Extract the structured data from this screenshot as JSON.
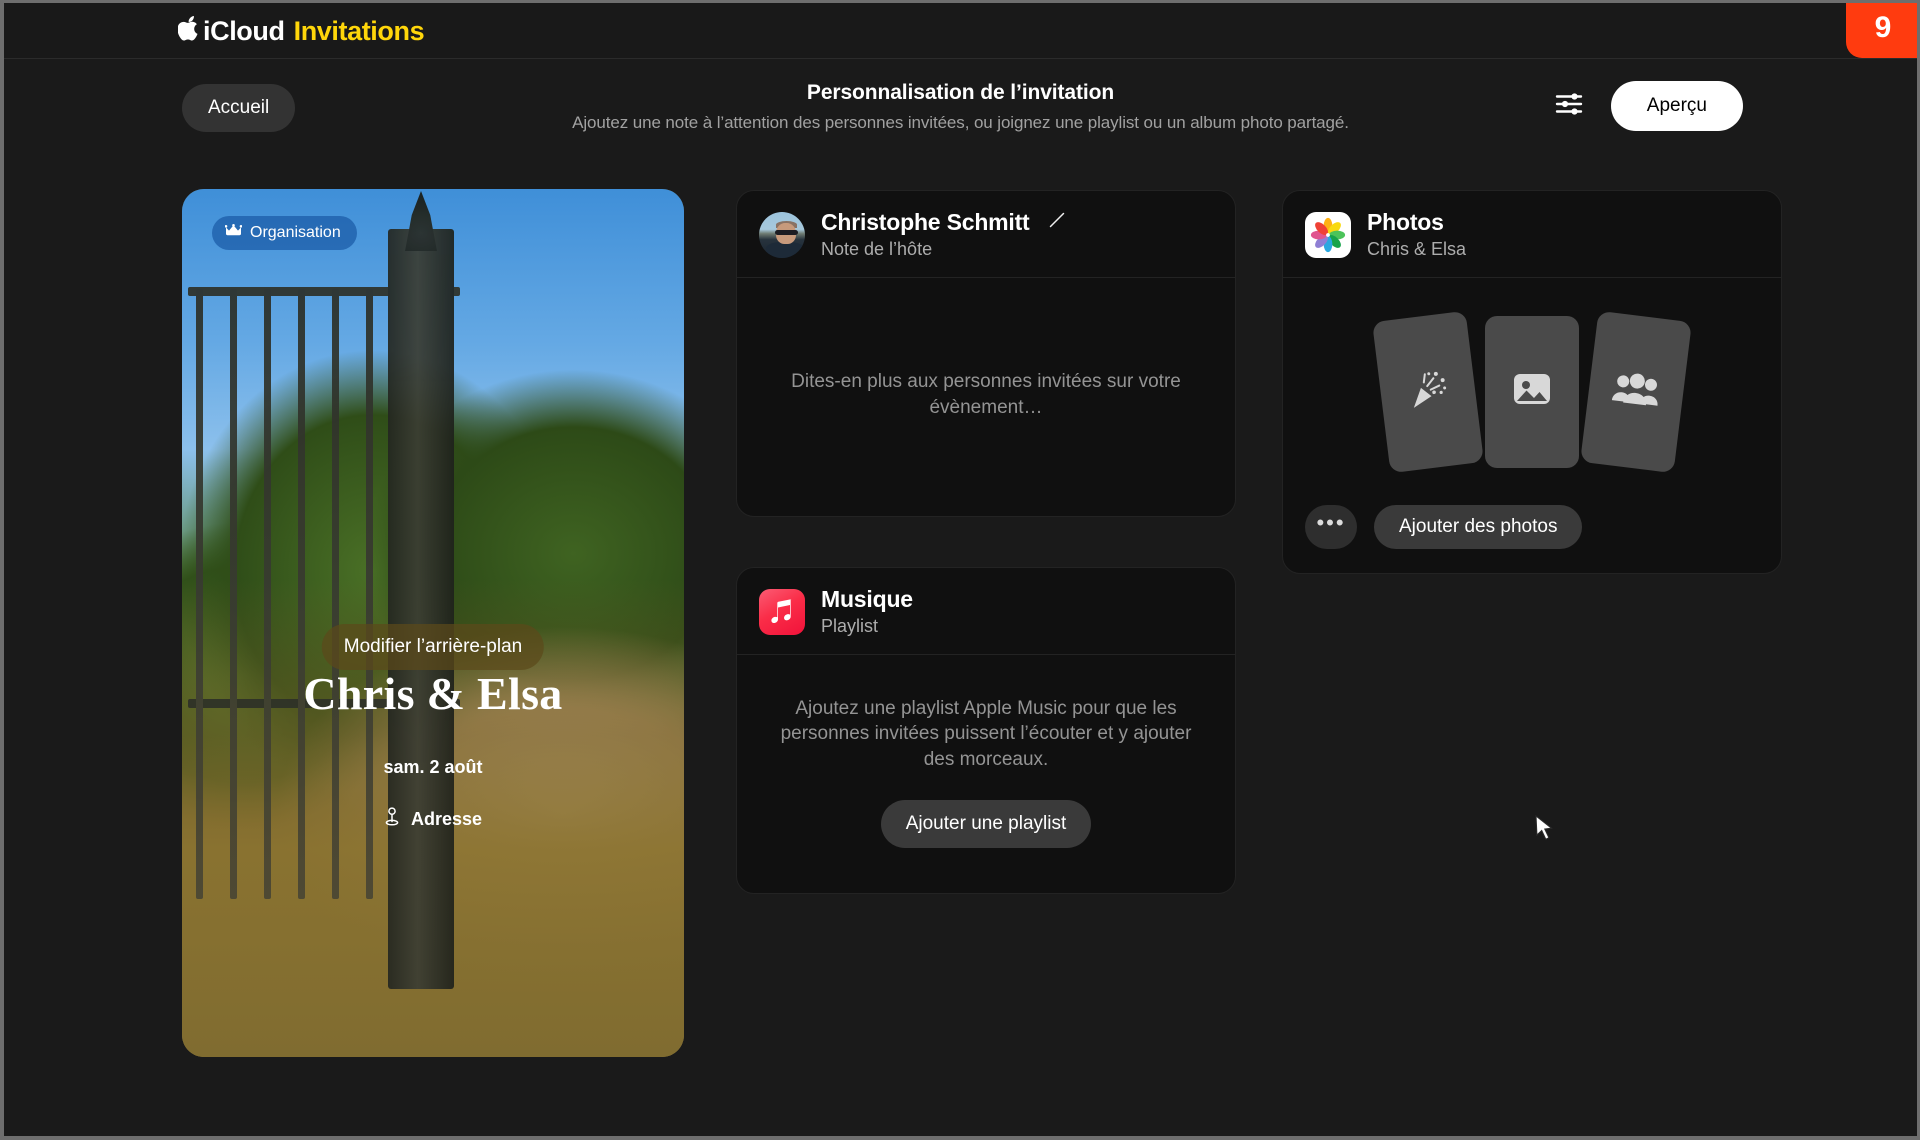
{
  "brand": {
    "apple_glyph": "",
    "icloud": "iCloud",
    "product": "Invitations",
    "notification_badge": "9",
    "badge_color": "#ff3b0f",
    "accent_color": "#ffd60a"
  },
  "header": {
    "home_button": "Accueil",
    "title": "Personnalisation de l’invitation",
    "subtitle": "Ajoutez une note à l’attention des personnes invitées, ou joignez une playlist ou un album photo partagé.",
    "settings_icon": "sliders-icon",
    "preview_button": "Aperçu"
  },
  "invitation": {
    "organizer_badge": "Organisation",
    "organizer_badge_icon": "crown-icon",
    "edit_background_button": "Modifier l’arrière-plan",
    "event_name": "Chris & Elsa",
    "event_date": "sam. 2 août",
    "address_label": "Adresse",
    "address_icon": "map-pin-icon"
  },
  "host_note_card": {
    "title": "Christophe Schmitt",
    "subtitle": "Note de l’hôte",
    "edit_icon": "pencil-icon",
    "avatar": "avatar",
    "placeholder": "Dites-en plus aux personnes invitées sur votre évènement…"
  },
  "photos_card": {
    "title": "Photos",
    "subtitle": "Chris & Elsa",
    "app_icon": "photos-app-icon",
    "placeholder_icons": [
      "party-popper-icon",
      "image-icon",
      "people-group-icon"
    ],
    "more_button": "•••",
    "add_button": "Ajouter des photos"
  },
  "music_card": {
    "title": "Musique",
    "subtitle": "Playlist",
    "app_icon": "apple-music-icon",
    "placeholder": "Ajoutez une playlist Apple Music pour que les personnes invitées puissent l’écouter et y ajouter des morceaux.",
    "add_button": "Ajouter une playlist"
  }
}
